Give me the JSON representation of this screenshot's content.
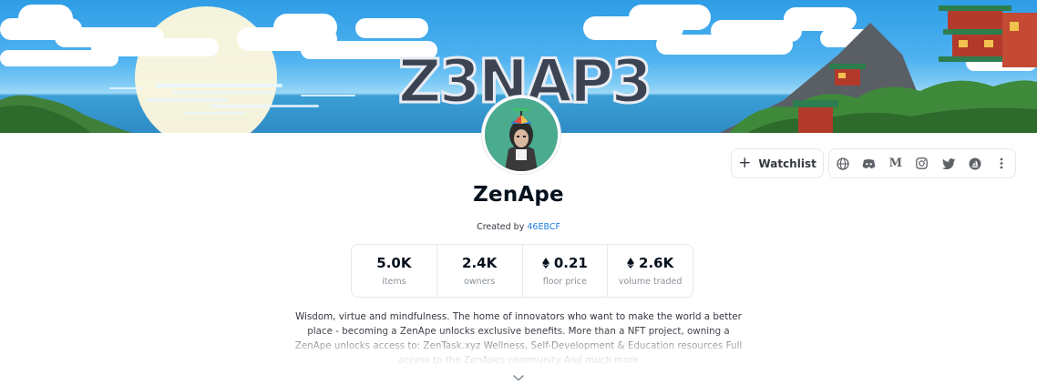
{
  "collection": {
    "name": "ZenApe",
    "created_by_prefix": "Created by",
    "creator": "46EBCF",
    "banner_logo_text": "Z3NAP3",
    "avatar": "zenape-avatar"
  },
  "actions": {
    "watchlist_label": "Watchlist",
    "watchlist_icon": "plus-icon",
    "social_icons": [
      "globe-icon",
      "discord-icon",
      "medium-icon",
      "instagram-icon",
      "twitter-icon",
      "opensea-icon",
      "more-icon"
    ],
    "medium_glyph": "M"
  },
  "stats": [
    {
      "value": "5.0K",
      "label": "items",
      "eth": false
    },
    {
      "value": "2.4K",
      "label": "owners",
      "eth": false
    },
    {
      "value": "0.21",
      "label": "floor price",
      "eth": true
    },
    {
      "value": "2.6K",
      "label": "volume traded",
      "eth": true
    }
  ],
  "description": "Wisdom, virtue and mindfulness. The home of innovators who want to make the world a better place - becoming a ZenApe unlocks exclusive benefits. More than a NFT project, owning a ZenApe unlocks access to: ZenTask.xyz Wellness, Self-Development & Education resources Full access to the ZenApes community And much more",
  "expand_icon": "chevron-down-icon",
  "colors": {
    "accent_link": "#2081e2",
    "avatar_bg": "#4bab8e",
    "border": "#e5e8eb",
    "muted_text": "#8a939b"
  }
}
